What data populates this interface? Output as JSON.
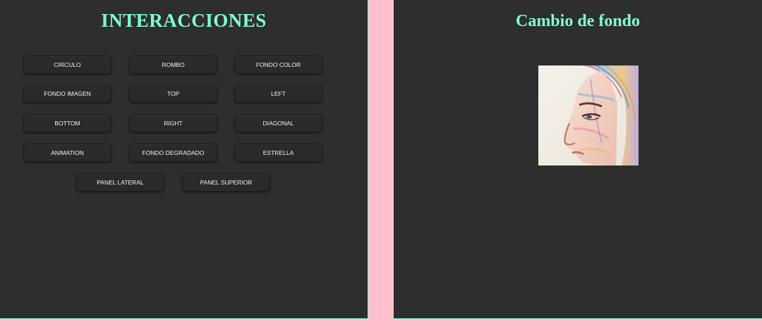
{
  "left_panel": {
    "title": "INTERACCIONES",
    "buttons": [
      "CIRCULO",
      "ROMBO",
      "FONDO COLOR",
      "FONDO IMAGEN",
      "TOP",
      "LEFT",
      "BOTTOM",
      "RIGHT",
      "DIAGONAL",
      "ANIMATION",
      "FONDO DEGRADADO",
      "ESTRELLA",
      "PANEL LATERAL",
      "PANEL SUPERIOR"
    ]
  },
  "right_panel": {
    "title": "Cambio de fondo",
    "image_subject": "colorful-sketch-portrait-of-woman-profile"
  },
  "colors": {
    "page_background": "#ffc0cb",
    "panel_background": "#2e2e2e",
    "accent": "#7fffd4",
    "button_text": "#f2f2f2"
  }
}
